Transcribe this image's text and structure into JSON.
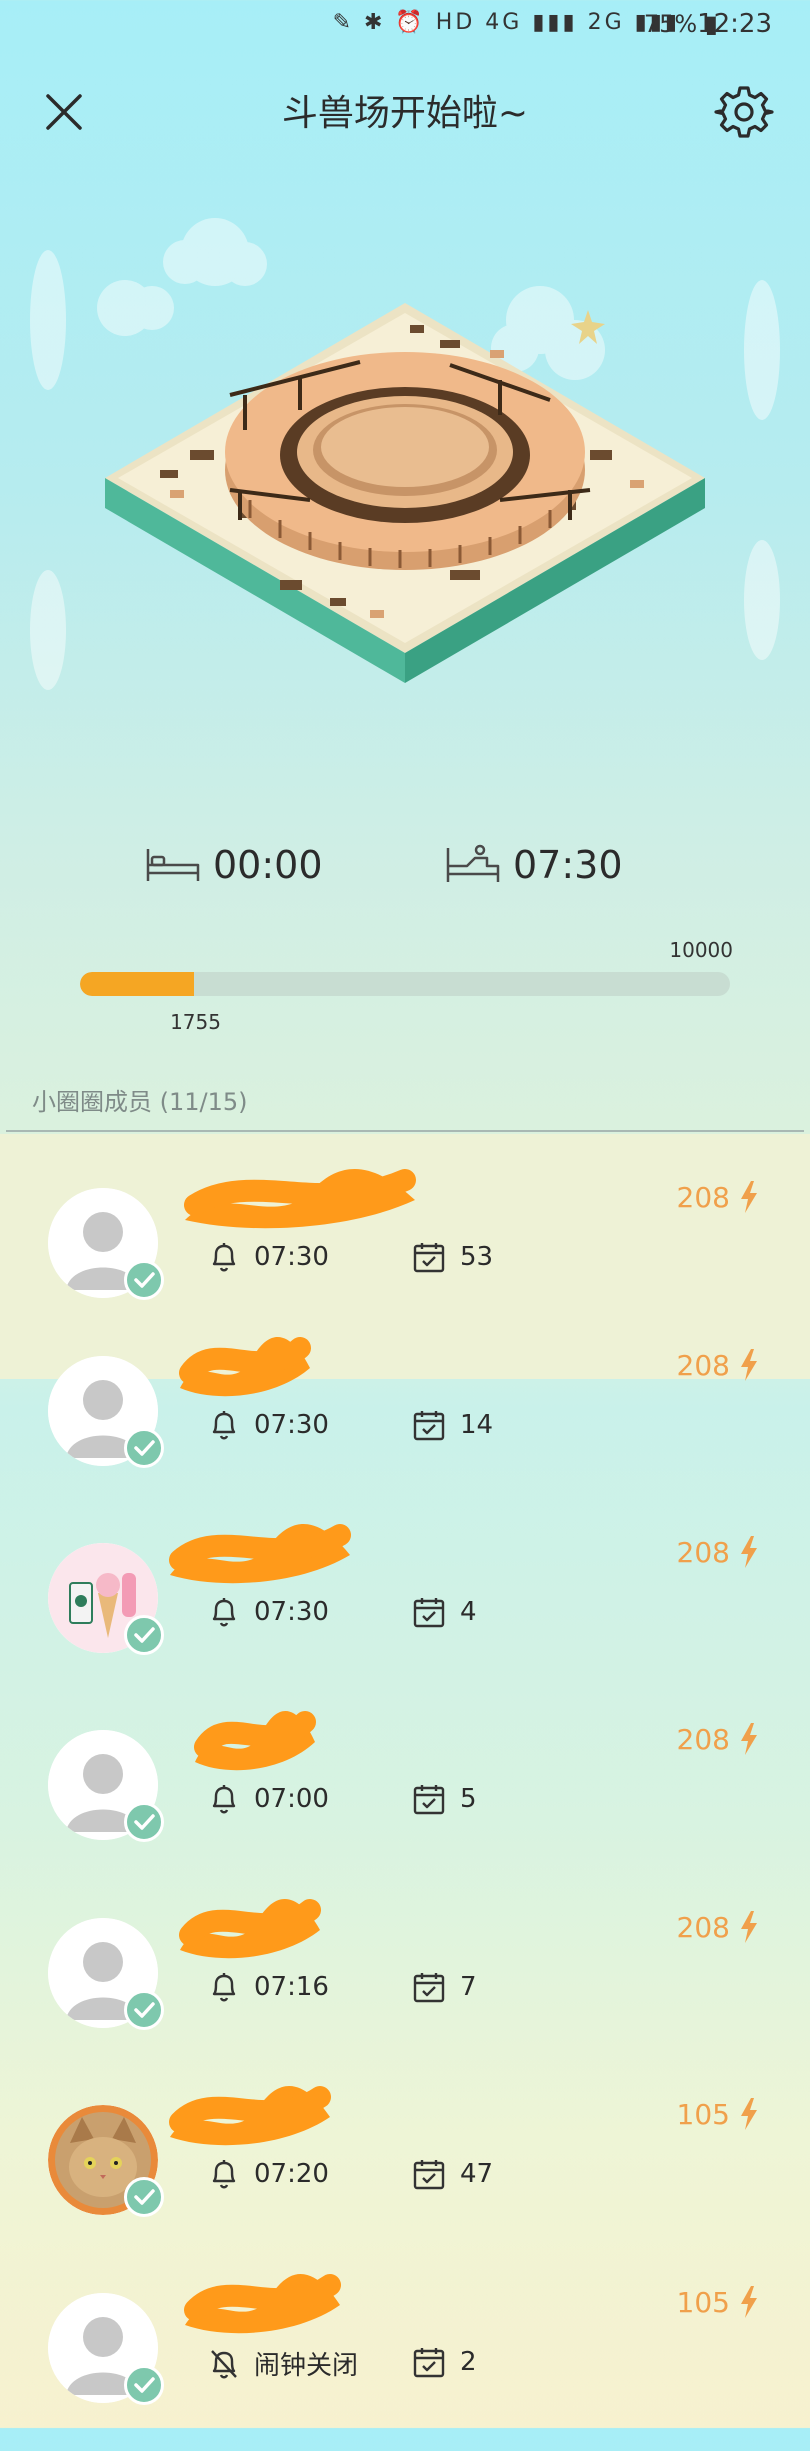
{
  "status_bar": {
    "icons": "✎ ✱ ⏰ HD 4G ▮▮▮ 2G ▮▮▮",
    "battery": "75% ▮",
    "time": "12:23"
  },
  "header": {
    "title": "斗兽场开始啦~"
  },
  "sleep": {
    "bed_time": "00:00",
    "wake_time": "07:30"
  },
  "progress": {
    "max_label": "10000",
    "current_label": "1755",
    "fraction": 0.1755
  },
  "members_section": {
    "label": "小圈圈成员 (11/15)"
  },
  "colors": {
    "accent": "#f5a623",
    "energy": "#f0a04b",
    "badge": "#7ec8ad",
    "scribble": "#ff9a1a"
  },
  "members": [
    {
      "alarm": "07:30",
      "days": "53",
      "energy": "208",
      "avatar": "default-avatar"
    },
    {
      "alarm": "07:30",
      "days": "14",
      "energy": "208",
      "avatar": "default-avatar"
    },
    {
      "alarm": "07:30",
      "days": "4",
      "energy": "208",
      "avatar": "drinks-avatar"
    },
    {
      "alarm": "07:00",
      "days": "5",
      "energy": "208",
      "avatar": "default-avatar"
    },
    {
      "alarm": "07:16",
      "days": "7",
      "energy": "208",
      "avatar": "default-avatar"
    },
    {
      "alarm": "07:20",
      "days": "47",
      "energy": "105",
      "avatar": "cat-avatar"
    },
    {
      "alarm": "闹钟关闭",
      "days": "2",
      "energy": "105",
      "avatar": "default-avatar",
      "alarm_off": true
    }
  ]
}
